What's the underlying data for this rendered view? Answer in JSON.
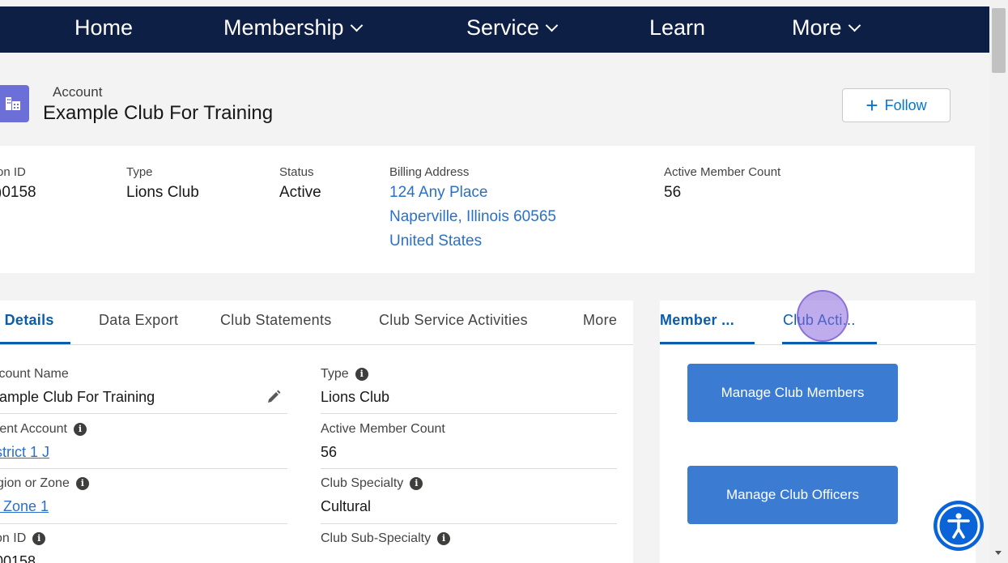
{
  "nav": {
    "items": [
      {
        "label": "Home"
      },
      {
        "label": "Membership"
      },
      {
        "label": "Service"
      },
      {
        "label": "Learn"
      },
      {
        "label": "More"
      }
    ]
  },
  "header": {
    "object_label": "Account",
    "title": "Example Club For Training",
    "follow_label": "Follow"
  },
  "highlights": {
    "id_label": "on ID",
    "id_value": ")0158",
    "type_label": "Type",
    "type_value": "Lions Club",
    "status_label": "Status",
    "status_value": "Active",
    "billing_label": "Billing Address",
    "billing_line1": "124 Any Place",
    "billing_line2": "Naperville, Illinois 60565",
    "billing_line3": "United States",
    "count_label": "Active Member Count",
    "count_value": "56"
  },
  "tabs": [
    {
      "label": "› Details"
    },
    {
      "label": "Data Export"
    },
    {
      "label": "Club Statements"
    },
    {
      "label": "Club Service Activities"
    },
    {
      "label": "More"
    }
  ],
  "details": {
    "account_name_label": ":count Name",
    "account_name_value": ":ample Club For Training",
    "parent_label": "rent Account",
    "parent_value": "strict 1 J",
    "region_label": "gion or Zone",
    "region_value": "Zone 1",
    "id_label": "on ID",
    "id_value": "00158",
    "type_label": "Type",
    "type_value": "Lions Club",
    "count_label": "Active Member Count",
    "count_value": "56",
    "specialty_label": "Club Specialty",
    "specialty_value": "Cultural",
    "subspecialty_label": "Club Sub-Specialty"
  },
  "side": {
    "tab1": "Member ...",
    "tab2": "Club Acti...",
    "btn_members": "Manage Club Members",
    "btn_officers": "Manage Club Officers"
  },
  "colors": {
    "nav_bg": "#0d1f45",
    "link": "#2a70c9",
    "brand_button": "#3b7bd1",
    "account_icon": "#6b6fd7",
    "a11y": "#0a64d8"
  },
  "icons": [
    "chevron-down-icon",
    "account-icon",
    "plus-icon",
    "info-icon",
    "pencil-icon",
    "accessibility-icon"
  ]
}
